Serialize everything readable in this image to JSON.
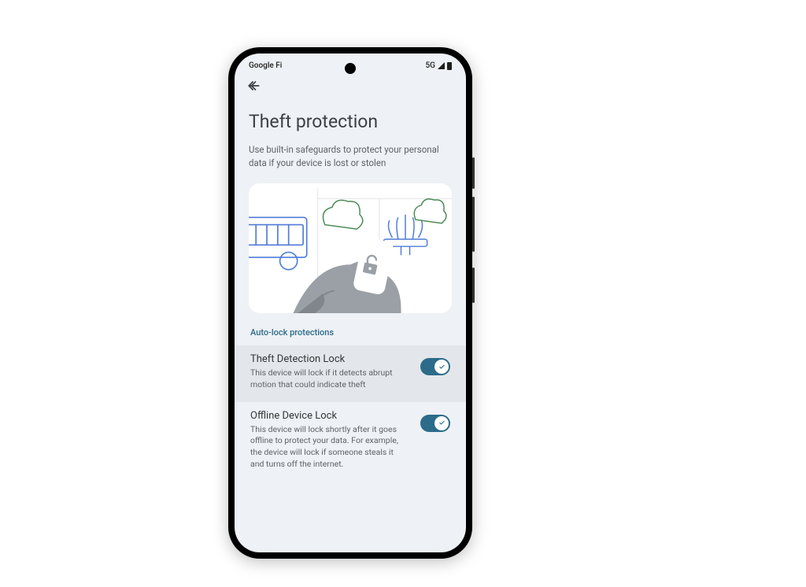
{
  "statusBar": {
    "carrier": "Google Fi",
    "network": "5G"
  },
  "page": {
    "title": "Theft protection",
    "subtitle": "Use built-in safeguards to protect your personal data if your device is lost or stolen"
  },
  "sectionLabel": "Auto-lock protections",
  "settings": [
    {
      "title": "Theft Detection Lock",
      "desc": "This device will lock if it detects abrupt motion that could indicate theft",
      "enabled": true
    },
    {
      "title": "Offline Device Lock",
      "desc": "This device will lock shortly after it goes offline to protect your data. For example, the device will lock if someone steals it and turns off the internet.",
      "enabled": true
    }
  ],
  "colors": {
    "accent": "#2c6b8a",
    "screenBg": "#eef1f5",
    "highlight": "#e3e7eb"
  }
}
